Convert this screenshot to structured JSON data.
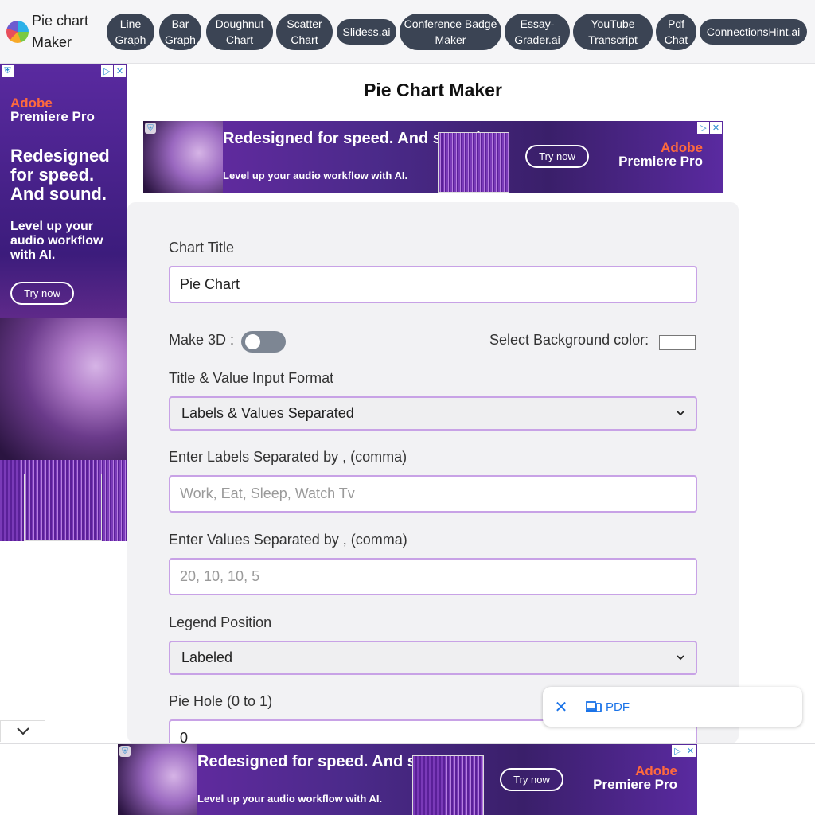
{
  "brand": {
    "name": "Pie chart Maker"
  },
  "nav": [
    {
      "label": "Line Graph"
    },
    {
      "label": "Bar Graph"
    },
    {
      "label": "Doughnut Chart"
    },
    {
      "label": "Scatter Chart"
    },
    {
      "label": "Slidess.ai"
    },
    {
      "label": "Conference Badge Maker"
    },
    {
      "label": "Essay-Grader.ai"
    },
    {
      "label": "YouTube Transcript"
    },
    {
      "label": "Pdf Chat"
    },
    {
      "label": "ConnectionsHint.ai"
    }
  ],
  "page": {
    "title": "Pie Chart Maker"
  },
  "ad": {
    "brand_name": "Adobe",
    "brand_product": "Premiere Pro",
    "headline_banner": "Redesigned for speed. And sound.",
    "sub_banner": "Level up your audio workflow with AI.",
    "headline_side": "Redesigned for speed. And sound.",
    "sub_side": "Level up your audio workflow with AI.",
    "cta": "Try now"
  },
  "form": {
    "chart_title_label": "Chart Title",
    "chart_title_value": "Pie Chart",
    "make3d_label": "Make 3D :",
    "make3d_enabled": false,
    "bg_color_label": "Select Background color:",
    "bg_color_value": "#ffffff",
    "input_format_label": "Title & Value Input Format",
    "input_format_value": "Labels & Values Separated",
    "labels_label": "Enter Labels Separated by , (comma)",
    "labels_placeholder": "Work, Eat, Sleep, Watch Tv",
    "values_label": "Enter Values Separated by , (comma)",
    "values_placeholder": "20, 10, 10, 5",
    "legend_label": "Legend Position",
    "legend_value": "Labeled",
    "pie_hole_label": "Pie Hole (0 to 1)",
    "pie_hole_value": "0"
  },
  "pdf_widget": {
    "label": "PDF"
  },
  "colors": {
    "nav_pill": "#3b4454",
    "input_border": "#c8a2e6",
    "accent_link": "#1a73e8",
    "ad_accent": "#ff6a3d"
  }
}
